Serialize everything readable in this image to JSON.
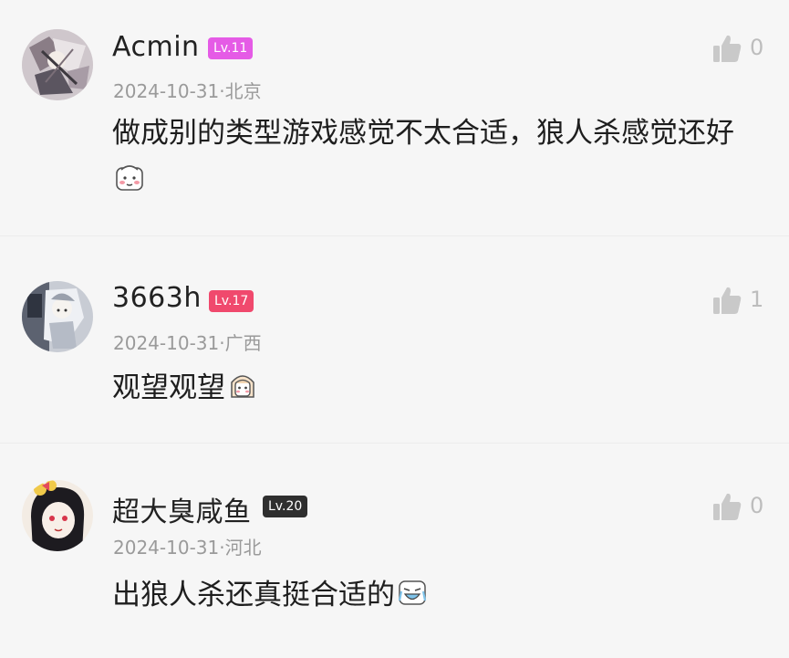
{
  "comments": [
    {
      "username": "Acmin",
      "level": "Lv.11",
      "level_color": "#e55be6",
      "date": "2024-10-31",
      "location": "北京",
      "text": "做成别的类型游戏感觉不太合适，狼人杀感觉还好",
      "emoji_icon": "shy-sticker-icon",
      "likes": "0"
    },
    {
      "username": "3663h",
      "level": "Lv.17",
      "level_color": "#f0496d",
      "date": "2024-10-31",
      "location": "广西",
      "text": "观望观望",
      "emoji_icon": "girl-sticker-icon",
      "likes": "1"
    },
    {
      "username": "超大臭咸鱼",
      "level": "Lv.20",
      "level_color": "#2f2f2f",
      "date": "2024-10-31",
      "location": "河北",
      "text": "出狼人杀还真挺合适的",
      "emoji_icon": "laughing-sticker-icon",
      "likes": "0"
    }
  ],
  "separator": "·"
}
